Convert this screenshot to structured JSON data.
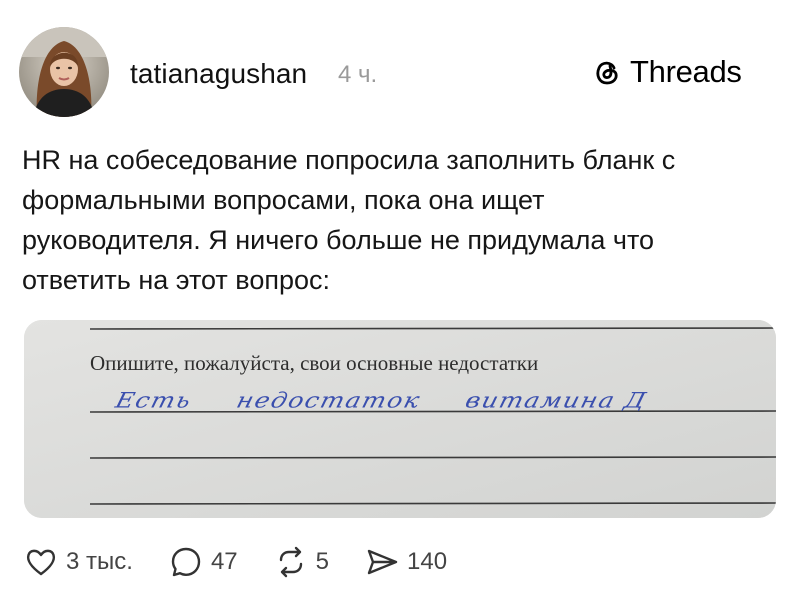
{
  "author": {
    "username": "tatianagushan",
    "time_ago": "4 ч.",
    "avatar_icon": "avatar-photo"
  },
  "brand": {
    "name": "Threads",
    "logo_icon": "threads-logo-icon"
  },
  "post": {
    "text_lines": [
      "HR на собеседование попросила заполнить бланк с",
      "формальными вопросами, пока она ищет",
      "руководителя. Я ничего больше не придумала что",
      "ответить на этот вопрос:"
    ]
  },
  "image": {
    "question": "Опишите, пожалуйста, свои основные недостатки",
    "handwriting": [
      "Есть",
      "недостаток",
      "витамина Д"
    ],
    "handwriting_color": "#3a4fae"
  },
  "actions": {
    "likes": "3 тыс.",
    "comments": "47",
    "reposts": "5",
    "shares": "140"
  }
}
